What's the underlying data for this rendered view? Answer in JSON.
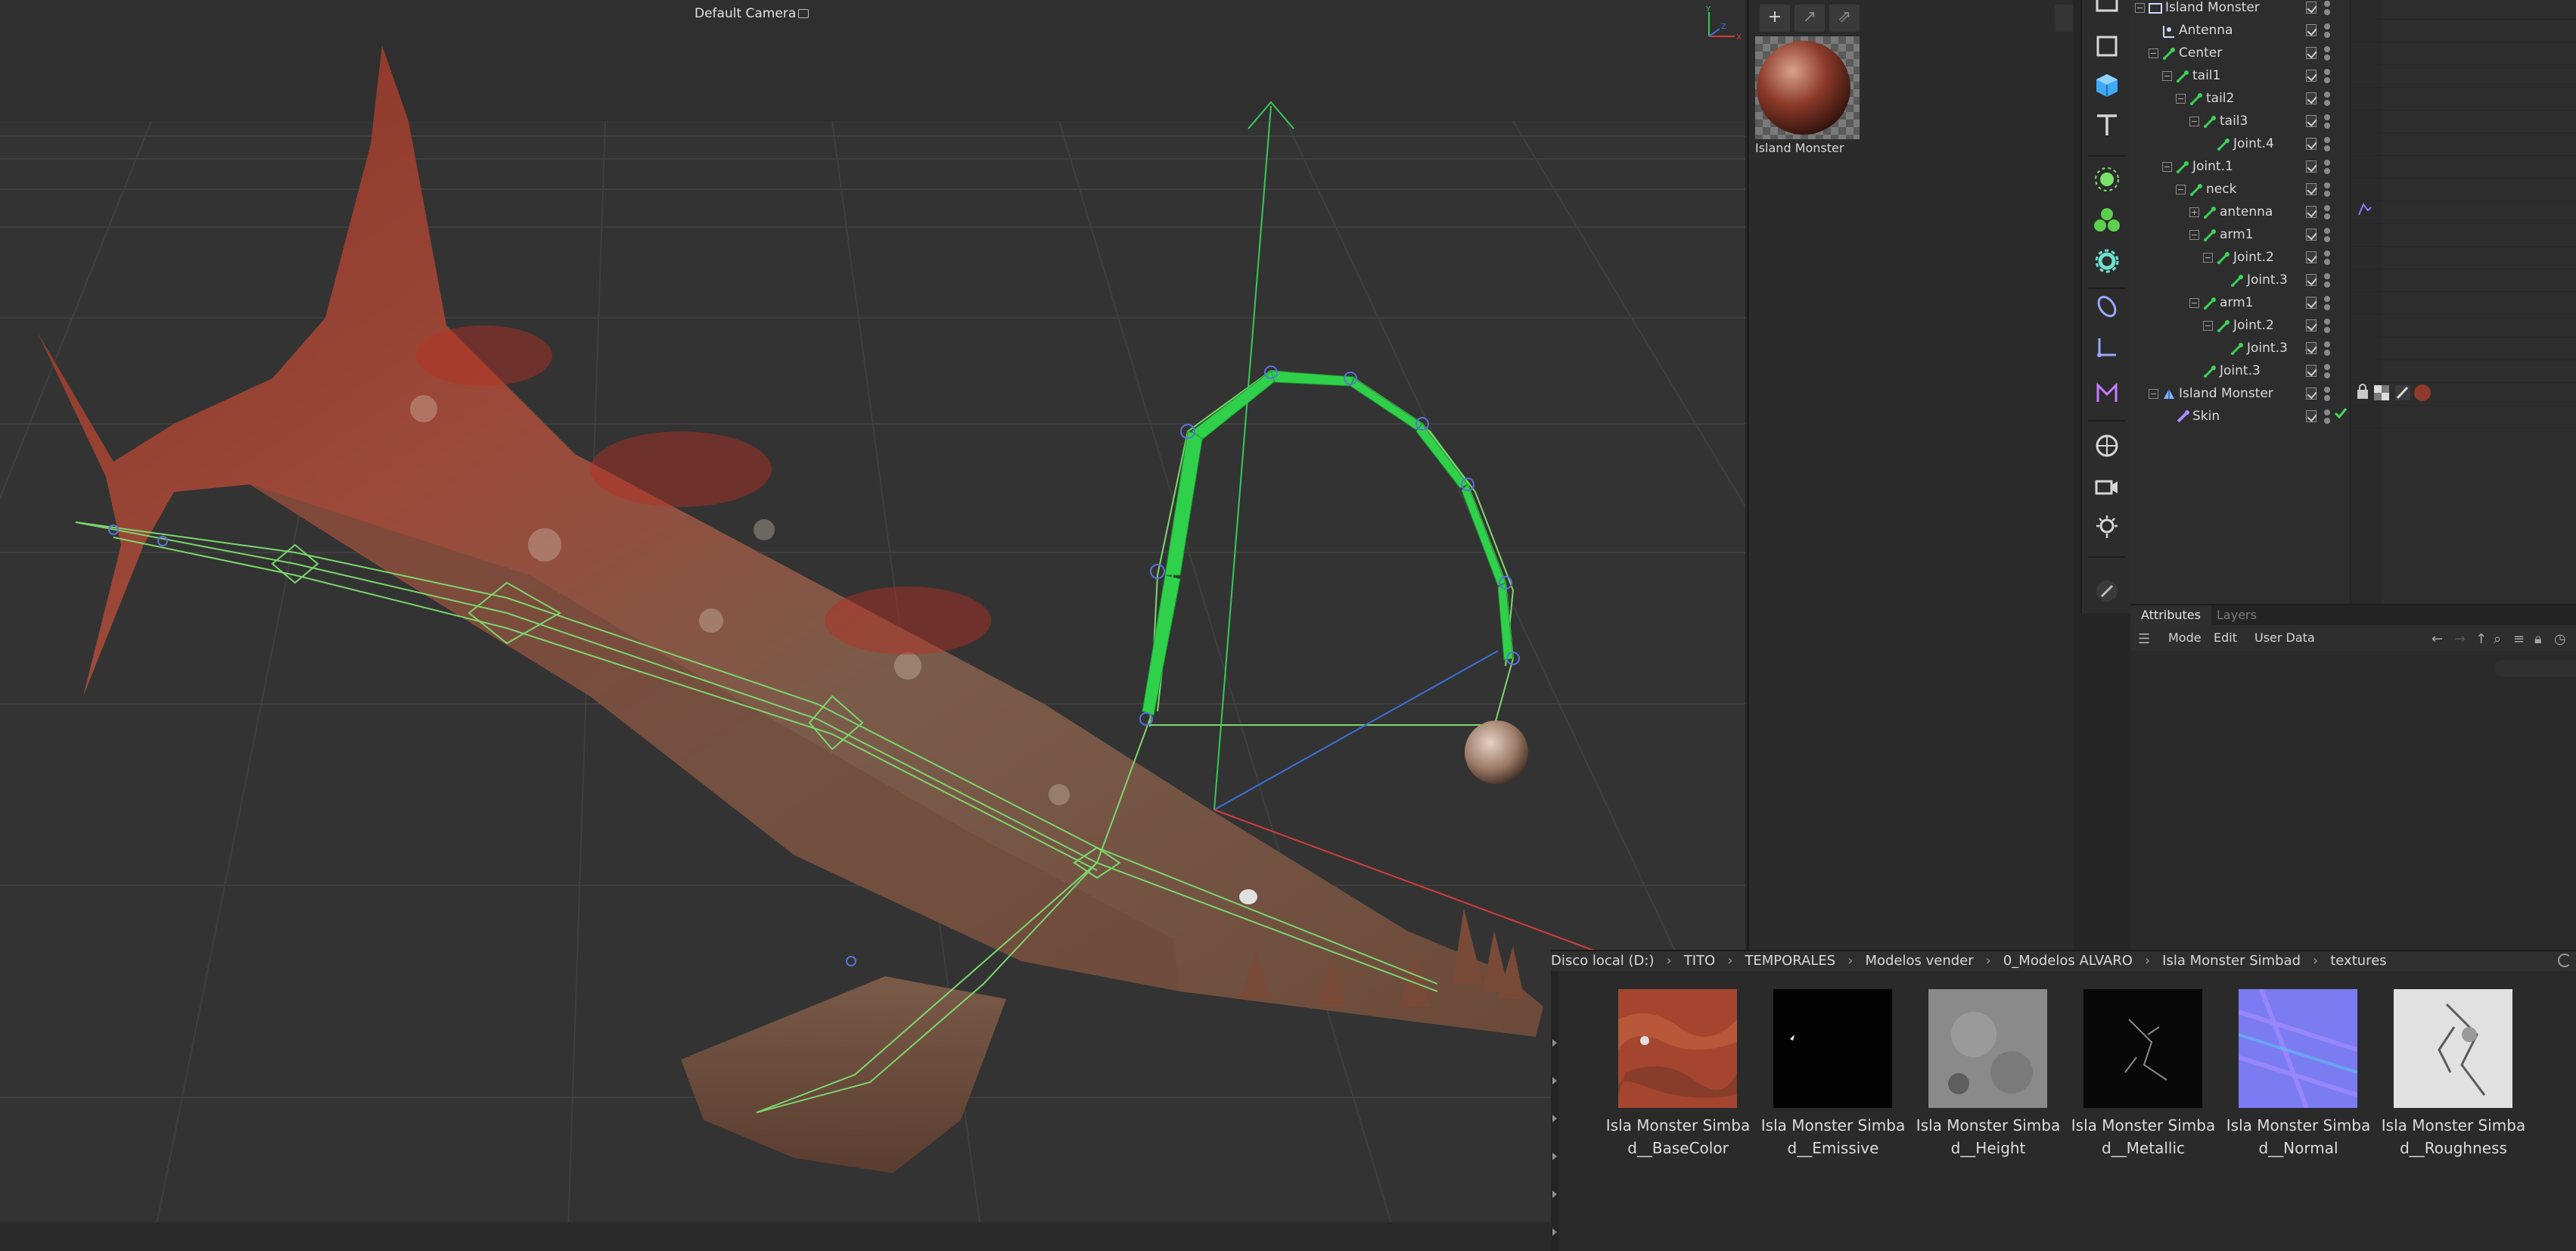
{
  "viewport": {
    "camera_label": "Default Camera",
    "axis_labels": {
      "y": "Y",
      "z": "Z",
      "x": "X"
    }
  },
  "material_panel": {
    "tools": {
      "add": "+",
      "arrow": "↗",
      "brush": "⇗"
    },
    "material_name": "Island Monster"
  },
  "object_manager": {
    "rows": [
      {
        "label": "Island Monster",
        "depth": 0,
        "expander": "−",
        "icon": "root"
      },
      {
        "label": "Antenna",
        "depth": 1,
        "expander": "",
        "icon": "joint-root"
      },
      {
        "label": "Center",
        "depth": 1,
        "expander": "−",
        "icon": "joint"
      },
      {
        "label": "tail1",
        "depth": 2,
        "expander": "−",
        "icon": "joint"
      },
      {
        "label": "tail2",
        "depth": 3,
        "expander": "−",
        "icon": "joint"
      },
      {
        "label": "tail3",
        "depth": 4,
        "expander": "−",
        "icon": "joint"
      },
      {
        "label": "Joint.4",
        "depth": 5,
        "expander": "",
        "icon": "joint"
      },
      {
        "label": "Joint.1",
        "depth": 2,
        "expander": "−",
        "icon": "joint"
      },
      {
        "label": "neck",
        "depth": 3,
        "expander": "−",
        "icon": "joint"
      },
      {
        "label": "antenna",
        "depth": 4,
        "expander": "+",
        "icon": "joint"
      },
      {
        "label": "arm1",
        "depth": 4,
        "expander": "−",
        "icon": "joint"
      },
      {
        "label": "Joint.2",
        "depth": 5,
        "expander": "−",
        "icon": "joint"
      },
      {
        "label": "Joint.3",
        "depth": 6,
        "expander": "",
        "icon": "joint"
      },
      {
        "label": "arm1",
        "depth": 4,
        "expander": "−",
        "icon": "joint"
      },
      {
        "label": "Joint.2",
        "depth": 5,
        "expander": "−",
        "icon": "joint"
      },
      {
        "label": "Joint.3",
        "depth": 6,
        "expander": "",
        "icon": "joint"
      },
      {
        "label": "Joint.3",
        "depth": 4,
        "expander": "",
        "icon": "joint"
      },
      {
        "label": "Island Monster",
        "depth": 1,
        "expander": "−",
        "icon": "mesh"
      },
      {
        "label": "Skin",
        "depth": 2,
        "expander": "",
        "icon": "skin"
      }
    ]
  },
  "attributes": {
    "tabs": [
      "Attributes",
      "Layers"
    ],
    "menu": {
      "mode": "Mode",
      "edit": "Edit",
      "user_data": "User Data"
    }
  },
  "asset_browser": {
    "breadcrumb": [
      "Disco local (D:)",
      "TITO",
      "TEMPORALES",
      "Modelos vender",
      "0_Modelos ALVARO",
      "Isla Monster Simbad",
      "textures"
    ],
    "assets": [
      {
        "label": "Isla Monster Simbad__BaseColor",
        "kind": "basecolor"
      },
      {
        "label": "Isla Monster Simbad__Emissive",
        "kind": "emissive"
      },
      {
        "label": "Isla Monster Simbad__Height",
        "kind": "height"
      },
      {
        "label": "Isla Monster Simbad__Metallic",
        "kind": "metallic"
      },
      {
        "label": "Isla Monster Simbad__Normal",
        "kind": "normal"
      },
      {
        "label": "Isla Monster Simbad__Roughness",
        "kind": "roughness"
      }
    ]
  },
  "colors": {
    "joint_green": "#3bd25a",
    "axis_y": "#37c95a",
    "axis_x": "#d23c3c",
    "axis_z": "#3b6fd6",
    "skin_red": "#9a3b2c"
  }
}
